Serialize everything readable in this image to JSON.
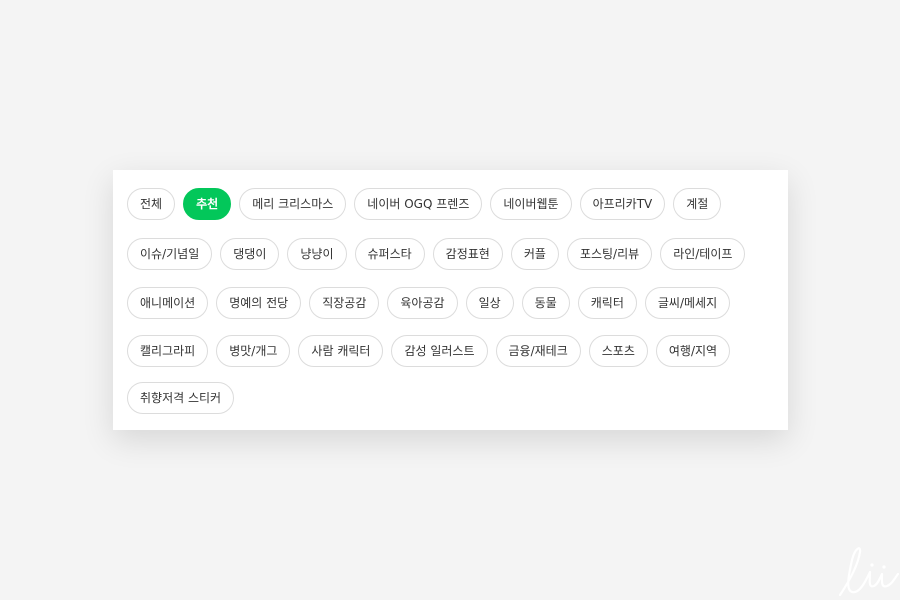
{
  "categories": {
    "rows": [
      [
        {
          "label": "전체",
          "active": false
        },
        {
          "label": "추천",
          "active": true
        },
        {
          "label": "메리 크리스마스",
          "active": false
        },
        {
          "label": "네이버 OGQ 프렌즈",
          "active": false
        },
        {
          "label": "네이버웹툰",
          "active": false
        },
        {
          "label": "아프리카TV",
          "active": false
        },
        {
          "label": "계절",
          "active": false
        }
      ],
      [
        {
          "label": "이슈/기념일",
          "active": false
        },
        {
          "label": "댕댕이",
          "active": false
        },
        {
          "label": "냥냥이",
          "active": false
        },
        {
          "label": "슈퍼스타",
          "active": false
        },
        {
          "label": "감정표현",
          "active": false
        },
        {
          "label": "커플",
          "active": false
        },
        {
          "label": "포스팅/리뷰",
          "active": false
        },
        {
          "label": "라인/테이프",
          "active": false
        }
      ],
      [
        {
          "label": "애니메이션",
          "active": false
        },
        {
          "label": "명예의 전당",
          "active": false
        },
        {
          "label": "직장공감",
          "active": false
        },
        {
          "label": "육아공감",
          "active": false
        },
        {
          "label": "일상",
          "active": false
        },
        {
          "label": "동물",
          "active": false
        },
        {
          "label": "캐릭터",
          "active": false
        },
        {
          "label": "글씨/메세지",
          "active": false
        }
      ],
      [
        {
          "label": "캘리그라피",
          "active": false
        },
        {
          "label": "병맛/개그",
          "active": false
        },
        {
          "label": "사람 캐릭터",
          "active": false
        },
        {
          "label": "감성 일러스트",
          "active": false
        },
        {
          "label": "금융/재테크",
          "active": false
        },
        {
          "label": "스포츠",
          "active": false
        },
        {
          "label": "여행/지역",
          "active": false
        }
      ],
      [
        {
          "label": "취향저격 스티커",
          "active": false
        }
      ]
    ]
  },
  "colors": {
    "active_chip": "#03c75a",
    "chip_border": "#dcdcdc",
    "background": "#f4f4f4"
  },
  "watermark": {
    "text": "liis"
  }
}
